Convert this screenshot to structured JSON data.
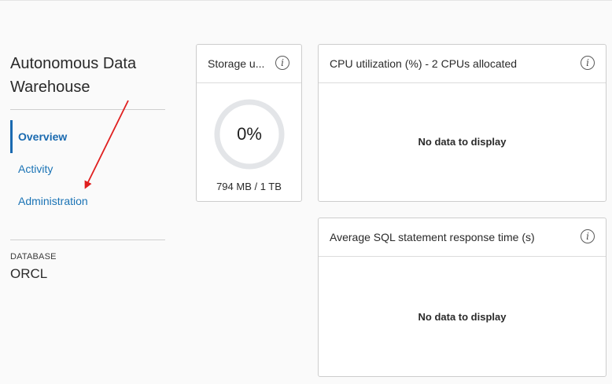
{
  "sidebar": {
    "app_title": "Autonomous Data Warehouse",
    "nav": [
      {
        "label": "Overview",
        "active": true
      },
      {
        "label": "Activity",
        "active": false
      },
      {
        "label": "Administration",
        "active": false
      }
    ],
    "database_label": "DATABASE",
    "database_name": "ORCL"
  },
  "cards": {
    "storage": {
      "title": "Storage u...",
      "percent_text": "0%",
      "percent": 0,
      "usage_text": "794 MB / 1 TB"
    },
    "cpu": {
      "title": "CPU utilization (%) - 2 CPUs allocated",
      "empty_text": "No data to display"
    },
    "sql_response": {
      "title": "Average SQL statement response time (s)",
      "empty_text": "No data to display"
    }
  },
  "info_icon_glyph": "i",
  "colors": {
    "accent": "#1a6ab0",
    "link": "#1a73b5",
    "gauge_track": "#e3e5e8",
    "annotation_arrow": "#e02020"
  }
}
